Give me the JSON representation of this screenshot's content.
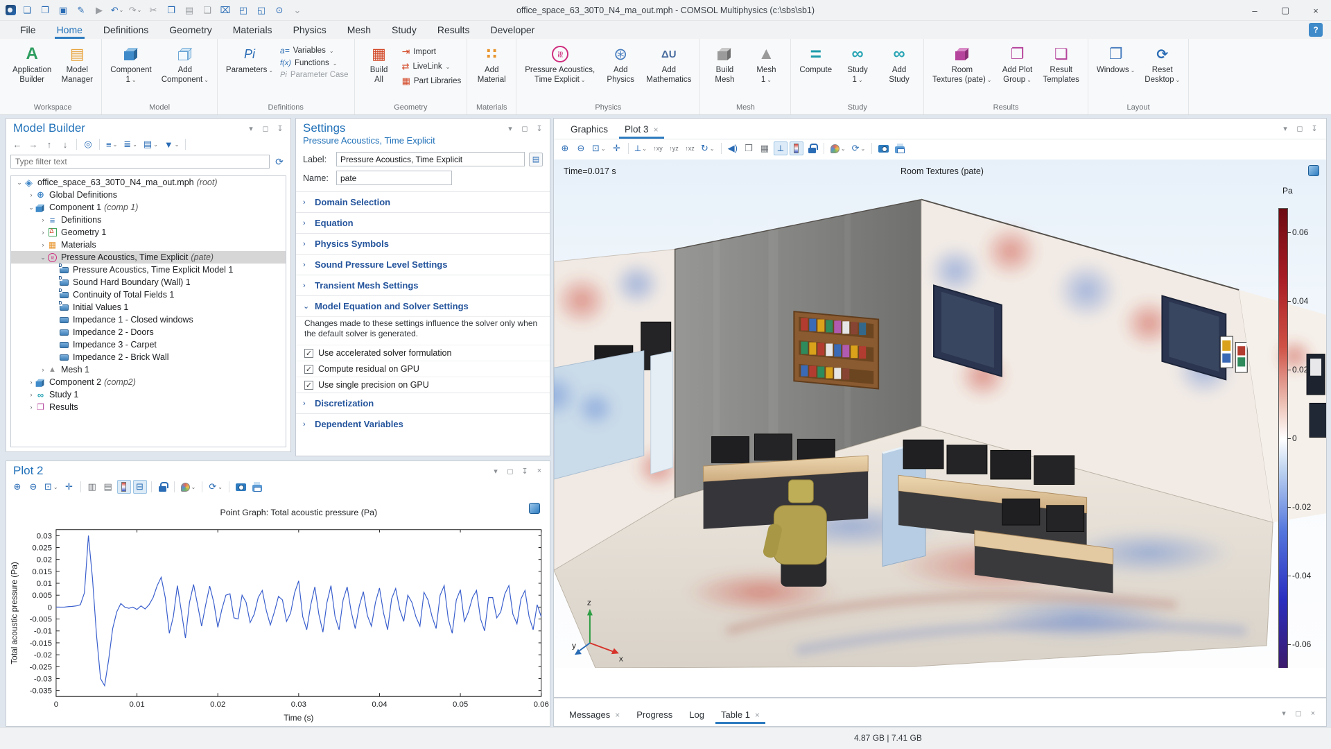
{
  "window": {
    "title": "office_space_63_30T0_N4_ma_out.mph - COMSOL Multiphysics (c:\\sbs\\sb1)",
    "controls": [
      "minimize",
      "maximize",
      "close"
    ]
  },
  "quick_access": [
    {
      "name": "comsol-logo"
    },
    {
      "name": "new-file"
    },
    {
      "name": "open-file"
    },
    {
      "name": "save"
    },
    {
      "name": "save-as"
    },
    {
      "name": "run",
      "muted": true
    },
    {
      "name": "undo",
      "dropdown": true
    },
    {
      "name": "redo",
      "muted": true,
      "dropdown": true
    },
    {
      "name": "cut",
      "muted": true
    },
    {
      "name": "copy"
    },
    {
      "name": "paste",
      "muted": true
    },
    {
      "name": "duplicate",
      "muted": true
    },
    {
      "name": "delete"
    },
    {
      "name": "select-box"
    },
    {
      "name": "clear-selection"
    },
    {
      "name": "find"
    },
    {
      "name": "customize-toolbar",
      "muted": true
    }
  ],
  "menu": {
    "items": [
      {
        "label": "File"
      },
      {
        "label": "Home",
        "active": true
      },
      {
        "label": "Definitions"
      },
      {
        "label": "Geometry"
      },
      {
        "label": "Materials"
      },
      {
        "label": "Physics"
      },
      {
        "label": "Mesh"
      },
      {
        "label": "Study"
      },
      {
        "label": "Results"
      },
      {
        "label": "Developer"
      }
    ],
    "help_label": "?"
  },
  "ribbon": {
    "groups": [
      {
        "name": "Workspace",
        "buttons": [
          {
            "name": "application-builder",
            "icon": "app-builder",
            "lines": [
              "Application",
              "Builder"
            ]
          },
          {
            "name": "model-manager",
            "icon": "model-manager",
            "lines": [
              "Model",
              "Manager"
            ]
          }
        ]
      },
      {
        "name": "Model",
        "buttons": [
          {
            "name": "component-1",
            "icon": "component",
            "lines": [
              "Component",
              "1"
            ],
            "dropdown": true
          },
          {
            "name": "add-component",
            "icon": "add-component",
            "lines": [
              "Add",
              "Component"
            ],
            "dropdown": true
          }
        ]
      },
      {
        "name": "Definitions",
        "buttons": [
          {
            "name": "parameters",
            "icon": "pi",
            "lines": [
              "Parameters"
            ],
            "dropdown": true
          }
        ],
        "stack": [
          {
            "name": "variables",
            "icon": "var",
            "label": "Variables",
            "dropdown": true
          },
          {
            "name": "functions",
            "icon": "fx",
            "label": "Functions",
            "dropdown": true
          },
          {
            "name": "parameter-case",
            "icon": "pi-small",
            "label": "Parameter Case",
            "disabled": true
          }
        ]
      },
      {
        "name": "Geometry",
        "buttons": [
          {
            "name": "build-all",
            "icon": "build-all",
            "lines": [
              "Build",
              "All"
            ]
          }
        ],
        "stack": [
          {
            "name": "import",
            "icon": "import",
            "label": "Import"
          },
          {
            "name": "livelink",
            "icon": "livelink",
            "label": "LiveLink",
            "dropdown": true
          },
          {
            "name": "part-libraries",
            "icon": "part-libraries",
            "label": "Part Libraries"
          }
        ]
      },
      {
        "name": "Materials",
        "buttons": [
          {
            "name": "add-material",
            "icon": "add-material",
            "lines": [
              "Add",
              "Material"
            ]
          }
        ]
      },
      {
        "name": "Physics",
        "buttons": [
          {
            "name": "pressure-acoustics-time-explicit",
            "icon": "acoustics",
            "lines": [
              "Pressure Acoustics,",
              "Time Explicit"
            ],
            "dropdown": true
          },
          {
            "name": "add-physics",
            "icon": "add-physics",
            "lines": [
              "Add",
              "Physics"
            ]
          },
          {
            "name": "add-mathematics",
            "icon": "add-math",
            "lines": [
              "Add",
              "Mathematics"
            ]
          }
        ]
      },
      {
        "name": "Mesh",
        "buttons": [
          {
            "name": "build-mesh",
            "icon": "build-mesh",
            "lines": [
              "Build",
              "Mesh"
            ]
          },
          {
            "name": "mesh-1",
            "icon": "mesh",
            "lines": [
              "Mesh",
              "1"
            ],
            "dropdown": true
          }
        ]
      },
      {
        "name": "Study",
        "buttons": [
          {
            "name": "compute",
            "icon": "compute",
            "lines": [
              "Compute"
            ]
          },
          {
            "name": "study-1",
            "icon": "study",
            "lines": [
              "Study",
              "1"
            ],
            "dropdown": true
          },
          {
            "name": "add-study",
            "icon": "add-study",
            "lines": [
              "Add",
              "Study"
            ]
          }
        ]
      },
      {
        "name": "Results",
        "buttons": [
          {
            "name": "room-textures-pate",
            "icon": "room-textures",
            "lines": [
              "Room",
              "Textures (pate)"
            ],
            "dropdown": true
          },
          {
            "name": "add-plot-group",
            "icon": "add-plot-group",
            "lines": [
              "Add Plot",
              "Group"
            ],
            "dropdown": true
          },
          {
            "name": "result-templates",
            "icon": "result-templates",
            "lines": [
              "Result",
              "Templates"
            ]
          }
        ]
      },
      {
        "name": "Layout",
        "buttons": [
          {
            "name": "windows",
            "icon": "windows",
            "lines": [
              "Windows"
            ],
            "dropdown": true
          },
          {
            "name": "reset-desktop",
            "icon": "reset-desktop",
            "lines": [
              "Reset",
              "Desktop"
            ],
            "dropdown": true
          }
        ]
      }
    ]
  },
  "model_builder": {
    "title": "Model Builder",
    "toolbar": [
      {
        "name": "back"
      },
      {
        "name": "forward"
      },
      {
        "name": "move-up"
      },
      {
        "name": "move-down"
      },
      {
        "name": "show"
      },
      {
        "name": "expand-all",
        "dropdown": true
      },
      {
        "name": "collapse-all",
        "dropdown": true
      },
      {
        "name": "node-text",
        "dropdown": true
      },
      {
        "name": "filter",
        "dropdown": true
      }
    ],
    "filter_placeholder": "Type filter text",
    "tree": [
      {
        "label": "office_space_63_30T0_N4_ma_out.mph",
        "suffix": "(root)",
        "icon": "root",
        "level": 0,
        "arrow": "expanded"
      },
      {
        "label": "Global Definitions",
        "icon": "globe",
        "level": 1,
        "arrow": "collapsed"
      },
      {
        "label": "Component 1",
        "suffix": "(comp 1)",
        "icon": "component",
        "level": 1,
        "arrow": "expanded"
      },
      {
        "label": "Definitions",
        "icon": "definitions",
        "level": 2,
        "arrow": "collapsed"
      },
      {
        "label": "Geometry 1",
        "icon": "geometry",
        "level": 2,
        "arrow": "collapsed"
      },
      {
        "label": "Materials",
        "icon": "materials",
        "level": 2,
        "arrow": "collapsed"
      },
      {
        "label": "Pressure Acoustics, Time Explicit",
        "suffix": "(pate)",
        "icon": "acoustics",
        "level": 2,
        "arrow": "expanded",
        "selected": true
      },
      {
        "label": "Pressure Acoustics, Time Explicit Model 1",
        "icon": "node-d",
        "level": 3
      },
      {
        "label": "Sound Hard Boundary (Wall) 1",
        "icon": "node-d",
        "level": 3
      },
      {
        "label": "Continuity of Total Fields 1",
        "icon": "node-d",
        "level": 3
      },
      {
        "label": "Initial Values 1",
        "icon": "node-d",
        "level": 3
      },
      {
        "label": "Impedance 1 - Closed windows",
        "icon": "node",
        "level": 3
      },
      {
        "label": "Impedance 2 - Doors",
        "icon": "node",
        "level": 3
      },
      {
        "label": "Impedance 3 - Carpet",
        "icon": "node",
        "level": 3
      },
      {
        "label": "Impedance 2 - Brick Wall",
        "icon": "node",
        "level": 3
      },
      {
        "label": "Mesh 1",
        "icon": "mesh",
        "level": 2,
        "arrow": "collapsed"
      },
      {
        "label": "Component 2",
        "suffix": "(comp2)",
        "icon": "component",
        "level": 1,
        "arrow": "collapsed"
      },
      {
        "label": "Study 1",
        "icon": "study",
        "level": 1,
        "arrow": "collapsed"
      },
      {
        "label": "Results",
        "icon": "results",
        "level": 1,
        "arrow": "collapsed"
      }
    ]
  },
  "settings": {
    "title": "Settings",
    "subtitle": "Pressure Acoustics, Time Explicit",
    "fields": [
      {
        "label": "Label:",
        "value": "Pressure Acoustics, Time Explicit",
        "button": "rename-label"
      },
      {
        "label": "Name:",
        "value": "pate",
        "short": true
      }
    ],
    "sections": [
      {
        "label": "Domain Selection",
        "state": "collapsed"
      },
      {
        "label": "Equation",
        "state": "collapsed"
      },
      {
        "label": "Physics Symbols",
        "state": "collapsed"
      },
      {
        "label": "Sound Pressure Level Settings",
        "state": "collapsed"
      },
      {
        "label": "Transient Mesh Settings",
        "state": "collapsed"
      },
      {
        "label": "Model Equation and Solver Settings",
        "state": "expanded",
        "note": "Changes made to these settings influence the solver only when the default solver is generated.",
        "checkboxes": [
          {
            "label": "Use accelerated solver formulation",
            "checked": true
          },
          {
            "label": "Compute residual on GPU",
            "checked": true
          },
          {
            "label": "Use single precision on GPU",
            "checked": true
          }
        ]
      },
      {
        "label": "Discretization",
        "state": "collapsed"
      },
      {
        "label": "Dependent Variables",
        "state": "collapsed"
      }
    ]
  },
  "plot2": {
    "title": "Plot 2",
    "toolbar": [
      {
        "name": "zoom-in"
      },
      {
        "name": "zoom-out"
      },
      {
        "name": "zoom-box",
        "dropdown": true
      },
      {
        "name": "zoom-extents"
      },
      {
        "name": "x-grid"
      },
      {
        "name": "y-grid"
      },
      {
        "name": "show-legend",
        "active": true
      },
      {
        "name": "show-annotation",
        "active": true
      },
      {
        "name": "lock-axes"
      },
      {
        "name": "color-theme",
        "dropdown": true
      },
      {
        "name": "update",
        "dropdown": true
      },
      {
        "name": "image-snapshot"
      },
      {
        "name": "print"
      }
    ],
    "chart_data": {
      "type": "line",
      "title": "Point Graph: Total acoustic pressure (Pa)",
      "xlabel": "Time (s)",
      "ylabel": "Total acoustic pressure (Pa)",
      "xlim": [
        0,
        0.06
      ],
      "ylim": [
        -0.0375,
        0.0325
      ],
      "xticks": [
        0,
        0.01,
        0.02,
        0.03,
        0.04,
        0.05,
        0.06
      ],
      "yticks": [
        0.03,
        0.025,
        0.02,
        0.015,
        0.01,
        0.005,
        0,
        -0.005,
        -0.01,
        -0.015,
        -0.02,
        -0.025,
        -0.03,
        -0.035
      ],
      "grid": false,
      "line_color": "#3a5fcd",
      "series": [
        {
          "name": "Total acoustic pressure",
          "x_start": 0,
          "x_step": 0.0005,
          "values": [
            0,
            0,
            0,
            0.0002,
            0.0003,
            0.0005,
            0.001,
            0.006,
            0.03,
            0.012,
            -0.012,
            -0.03,
            -0.033,
            -0.022,
            -0.009,
            -0.002,
            0.0015,
            0,
            -0.0005,
            0,
            -0.001,
            0.0005,
            -0.0008,
            0.001,
            0.004,
            0.009,
            0.0125,
            0.004,
            -0.011,
            -0.004,
            0.009,
            -0.002,
            -0.013,
            0.002,
            0.0095,
            0.001,
            -0.008,
            0.001,
            0.0088,
            0.002,
            -0.0085,
            -0.001,
            0.005,
            0.0056,
            -0.0045,
            -0.005,
            0.005,
            0.002,
            -0.0065,
            -0.003,
            0.004,
            0.007,
            -0.0015,
            -0.0075,
            -0.002,
            0.0045,
            0.003,
            -0.006,
            -0.0025,
            0.006,
            0.011,
            -0.004,
            -0.0095,
            0.001,
            0.0085,
            -0.003,
            -0.0105,
            0.002,
            0.009,
            -0.004,
            -0.0095,
            0.003,
            0.0085,
            -0.002,
            -0.009,
            0.0005,
            0.0065,
            -0.0035,
            -0.008,
            0.002,
            0.008,
            -0.0025,
            -0.0095,
            0.0035,
            0.0078,
            -0.001,
            -0.006,
            0.005,
            0.002,
            -0.004,
            -0.008,
            0.0062,
            0.003,
            -0.004,
            -0.009,
            0.005,
            0.009,
            -0.005,
            -0.011,
            0.003,
            0.0073,
            -0.006,
            -0.002,
            0.004,
            0.007,
            -0.005,
            -0.01,
            0.004,
            0.004,
            -0.0045,
            -0.002,
            0.0055,
            0.009,
            -0.003,
            -0.007,
            0.0035,
            0.007,
            -0.004,
            -0.0095,
            0.001,
            -0.004
          ]
        }
      ]
    }
  },
  "graphics": {
    "tabs": [
      {
        "label": "Graphics"
      },
      {
        "label": "Plot 3",
        "active": true,
        "closable": true
      }
    ],
    "toolbar": [
      {
        "name": "zoom-in"
      },
      {
        "name": "zoom-out"
      },
      {
        "name": "zoom-box",
        "dropdown": true
      },
      {
        "name": "zoom-extents"
      },
      {
        "name": "go-to-view",
        "dropdown": true
      },
      {
        "name": "view-xy"
      },
      {
        "name": "view-yz"
      },
      {
        "name": "view-xz"
      },
      {
        "name": "rotate",
        "dropdown": true
      },
      {
        "name": "scene-light"
      },
      {
        "name": "transparency"
      },
      {
        "name": "grid"
      },
      {
        "name": "show-axis-orientation",
        "active": true
      },
      {
        "name": "show-color-legend",
        "active": true
      },
      {
        "name": "lock-view"
      },
      {
        "name": "image-settings",
        "dropdown": true
      },
      {
        "name": "update",
        "dropdown": true
      },
      {
        "name": "image-snapshot"
      },
      {
        "name": "print"
      }
    ],
    "time_label": "Time=0.017 s",
    "plot_title": "Room Textures (pate)",
    "colorbar": {
      "unit": "Pa",
      "ticks": [
        "0.06",
        "0.04",
        "0.02",
        "0",
        "-0.02",
        "-0.04",
        "-0.06"
      ]
    },
    "axis_triad": {
      "x": "x",
      "y": "y",
      "z": "z"
    }
  },
  "bottom_tabs": [
    {
      "label": "Messages",
      "closable": true
    },
    {
      "label": "Progress"
    },
    {
      "label": "Log"
    },
    {
      "label": "Table 1",
      "active": true,
      "closable": true
    }
  ],
  "status_bar": {
    "memory": "4.87 GB | 7.41 GB"
  },
  "colors": {
    "accent": "#2a6cb5",
    "selection": "#d6d6d6",
    "plot_line": "#3a5fcd",
    "colorbar_top": "#6d0b12",
    "colorbar_bottom": "#3c1a6a"
  }
}
